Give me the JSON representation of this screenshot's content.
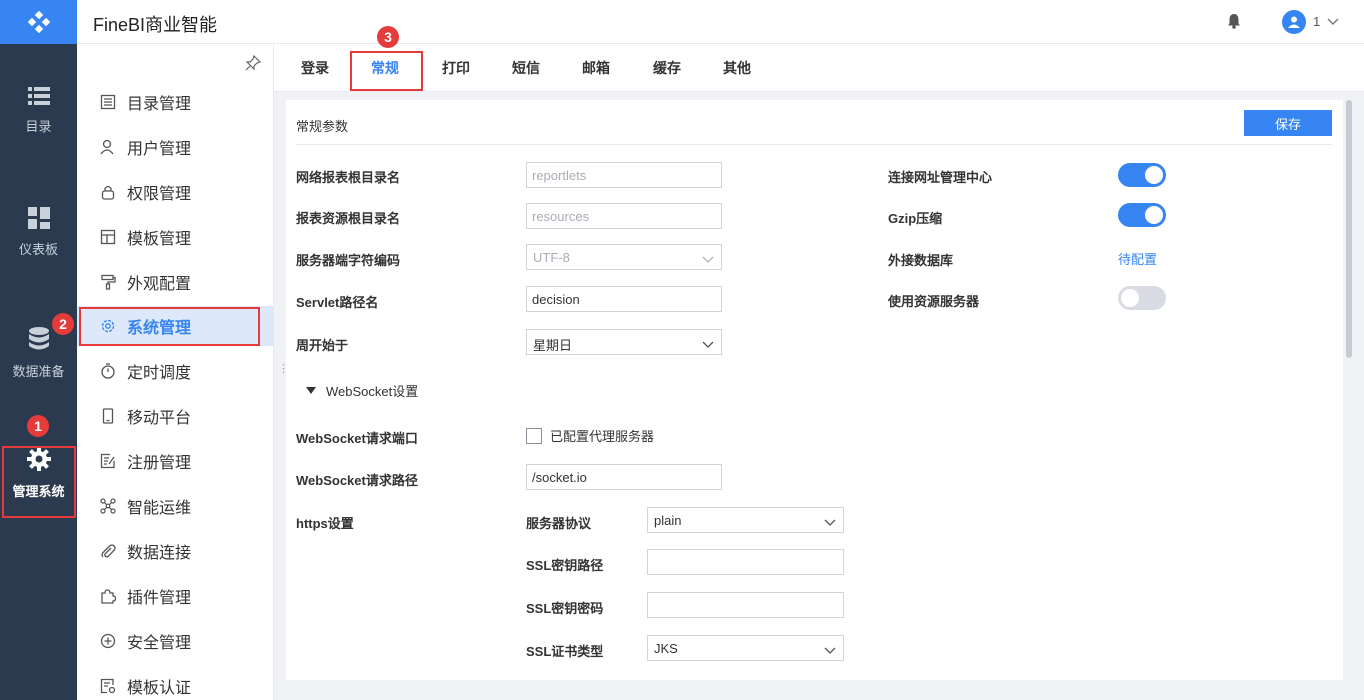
{
  "app": {
    "title": "FineBI商业智能"
  },
  "user": {
    "name": "1"
  },
  "rail": {
    "items": [
      {
        "label": "目录",
        "icon": "list-icon"
      },
      {
        "label": "仪表板",
        "icon": "dashboard-icon"
      },
      {
        "label": "数据准备",
        "icon": "database-icon"
      },
      {
        "label": "管理系统",
        "icon": "gear-icon",
        "active": true
      }
    ]
  },
  "submenu": {
    "items": [
      {
        "label": "目录管理",
        "icon": "catalog-icon"
      },
      {
        "label": "用户管理",
        "icon": "user-icon"
      },
      {
        "label": "权限管理",
        "icon": "lock-icon"
      },
      {
        "label": "模板管理",
        "icon": "template-icon"
      },
      {
        "label": "外观配置",
        "icon": "paint-roller-icon"
      },
      {
        "label": "系统管理",
        "icon": "gear-icon",
        "active": true
      },
      {
        "label": "定时调度",
        "icon": "timer-icon"
      },
      {
        "label": "移动平台",
        "icon": "mobile-icon"
      },
      {
        "label": "注册管理",
        "icon": "register-icon"
      },
      {
        "label": "智能运维",
        "icon": "network-icon"
      },
      {
        "label": "数据连接",
        "icon": "paperclip-icon"
      },
      {
        "label": "插件管理",
        "icon": "puzzle-icon"
      },
      {
        "label": "安全管理",
        "icon": "shield-icon"
      },
      {
        "label": "模板认证",
        "icon": "certificate-icon"
      }
    ]
  },
  "tabs": [
    {
      "label": "登录"
    },
    {
      "label": "常规",
      "active": true
    },
    {
      "label": "打印"
    },
    {
      "label": "短信"
    },
    {
      "label": "邮箱"
    },
    {
      "label": "缓存"
    },
    {
      "label": "其他"
    }
  ],
  "panel": {
    "title": "常规参数",
    "save_label": "保存",
    "fields": {
      "web_root": {
        "label": "网络报表根目录名",
        "value": "reportlets"
      },
      "resource_root": {
        "label": "报表资源根目录名",
        "value": "resources"
      },
      "encoding": {
        "label": "服务器端字符编码",
        "value": "UTF-8"
      },
      "servlet_path": {
        "label": "Servlet路径名",
        "value": "decision"
      },
      "week_start": {
        "label": "周开始于",
        "value": "星期日"
      },
      "connect_center": {
        "label": "连接网址管理中心",
        "on": true
      },
      "gzip": {
        "label": "Gzip压缩",
        "on": true
      },
      "external_db": {
        "label": "外接数据库",
        "link": "待配置"
      },
      "resource_server": {
        "label": "使用资源服务器",
        "on": false
      }
    },
    "websocket": {
      "section_label": "WebSocket设置",
      "port_label": "WebSocket请求端口",
      "proxy_label": "已配置代理服务器",
      "path_label": "WebSocket请求路径",
      "path_value": "/socket.io"
    },
    "https": {
      "label": "https设置",
      "protocol_label": "服务器协议",
      "protocol_value": "plain",
      "ssl_path_label": "SSL密钥路径",
      "ssl_path_value": "",
      "ssl_pwd_label": "SSL密钥密码",
      "ssl_pwd_value": "",
      "cert_type_label": "SSL证书类型",
      "cert_type_value": "JKS"
    }
  },
  "annotations": [
    "1",
    "2",
    "3"
  ]
}
